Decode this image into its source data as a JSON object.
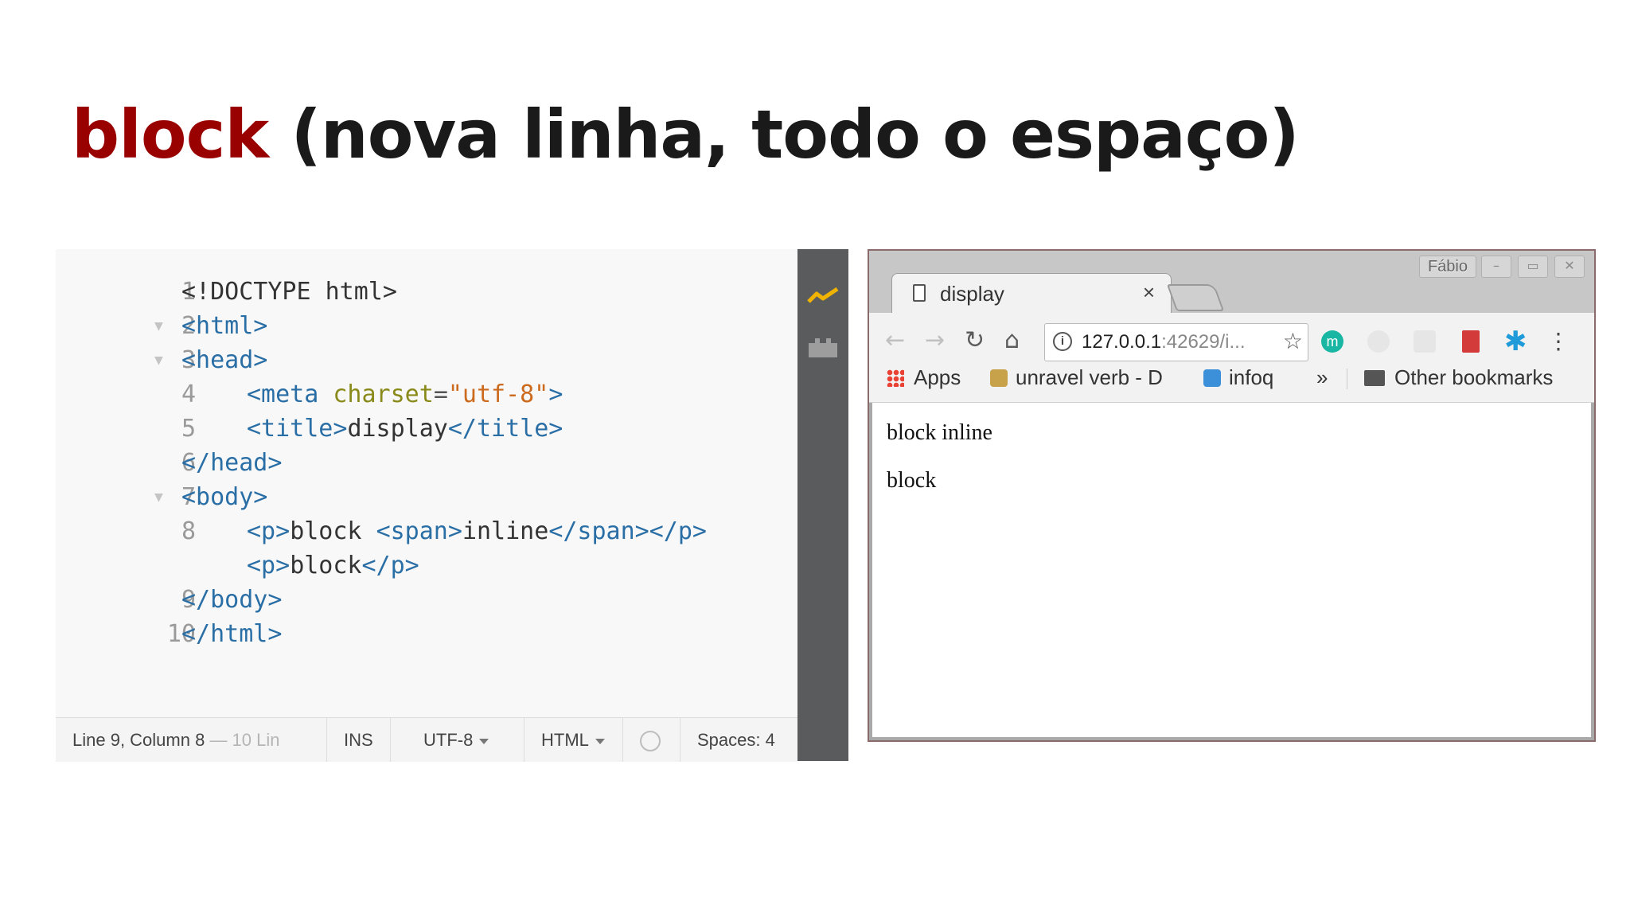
{
  "slide": {
    "title_keyword": "block",
    "title_rest": " (nova linha, todo o espaço)"
  },
  "editor": {
    "lines": [
      {
        "num": "1",
        "indent": false,
        "fold": false,
        "tokens": [
          {
            "t": "<!DOCTYPE html>",
            "c": "text"
          }
        ]
      },
      {
        "num": "2",
        "indent": false,
        "fold": true,
        "tokens": [
          {
            "t": "<html>",
            "c": "tag"
          }
        ]
      },
      {
        "num": "3",
        "indent": false,
        "fold": true,
        "tokens": [
          {
            "t": "<head>",
            "c": "tag"
          }
        ]
      },
      {
        "num": "4",
        "indent": true,
        "fold": false,
        "tokens": [
          {
            "t": "<meta ",
            "c": "tag"
          },
          {
            "t": "charset",
            "c": "attr"
          },
          {
            "t": "=",
            "c": "punct"
          },
          {
            "t": "\"utf-8\"",
            "c": "str"
          },
          {
            "t": ">",
            "c": "tag"
          }
        ]
      },
      {
        "num": "5",
        "indent": true,
        "fold": false,
        "tokens": [
          {
            "t": "<title>",
            "c": "tag"
          },
          {
            "t": "display",
            "c": "text"
          },
          {
            "t": "</title>",
            "c": "tag"
          }
        ]
      },
      {
        "num": "6",
        "indent": false,
        "fold": false,
        "tokens": [
          {
            "t": "</head>",
            "c": "tag"
          }
        ]
      },
      {
        "num": "7",
        "indent": false,
        "fold": true,
        "tokens": [
          {
            "t": "<body>",
            "c": "tag"
          }
        ]
      },
      {
        "num": "8",
        "indent": true,
        "fold": false,
        "tokens": [
          {
            "t": "<p>",
            "c": "tag"
          },
          {
            "t": "block ",
            "c": "text"
          },
          {
            "t": "<span>",
            "c": "tag"
          },
          {
            "t": "inline",
            "c": "text"
          },
          {
            "t": "</span></p>",
            "c": "tag"
          }
        ]
      },
      {
        "num": "",
        "indent": true,
        "fold": false,
        "tokens": [
          {
            "t": "<p>",
            "c": "tag"
          },
          {
            "t": "block",
            "c": "text"
          },
          {
            "t": "</p>",
            "c": "tag"
          }
        ]
      },
      {
        "num": "9",
        "indent": false,
        "fold": false,
        "tokens": [
          {
            "t": "</body>",
            "c": "tag"
          }
        ]
      },
      {
        "num": "10",
        "indent": false,
        "fold": false,
        "tokens": [
          {
            "t": "</html>",
            "c": "tag"
          }
        ]
      }
    ],
    "fold_glyph": "▼",
    "status": {
      "position": "Line 9, Column 8",
      "line_count": " — 10 Lin",
      "mode": "INS",
      "encoding": "UTF-8",
      "language": "HTML",
      "spaces": "Spaces:  4"
    },
    "toolbar_icons": [
      "live-preview-icon",
      "extension-manager-icon"
    ]
  },
  "browser": {
    "window_label": "Fábio",
    "window_buttons": [
      "–",
      "▭",
      "✕"
    ],
    "tab_title": "display",
    "tab_close": "×",
    "nav": {
      "back": "←",
      "forward": "→",
      "reload": "↻",
      "home": "⌂",
      "star": "☆",
      "info": "i",
      "menu": "⋮"
    },
    "url_host": "127.0.0.1",
    "url_rest": ":42629/i...",
    "extension_m": "m",
    "bookmarks": {
      "apps": "Apps",
      "item1": "unravel verb - D",
      "item2": "infoq",
      "more": "»",
      "other": "Other bookmarks"
    },
    "content": {
      "p1": "block inline",
      "p2": "block"
    }
  }
}
